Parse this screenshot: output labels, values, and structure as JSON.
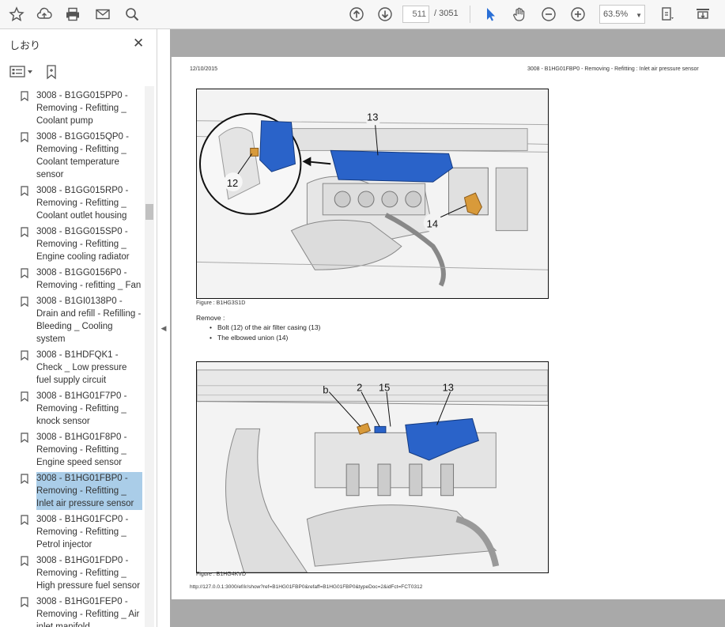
{
  "toolbar": {
    "page_current": "511",
    "page_total": "/ 3051",
    "zoom": "63.5%"
  },
  "sidebar": {
    "title": "しおり",
    "bookmarks": [
      {
        "label": "3008 - B1GG015PP0 - Removing - Refitting _ Coolant pump"
      },
      {
        "label": "3008 - B1GG015QP0 - Removing - Refitting _ Coolant temperature sensor"
      },
      {
        "label": "3008 - B1GG015RP0 - Removing - Refitting _ Coolant outlet housing"
      },
      {
        "label": "3008 - B1GG015SP0 - Removing - Refitting _ Engine cooling radiator"
      },
      {
        "label": "3008 - B1GG0156P0 - Removing - refitting _ Fan"
      },
      {
        "label": "3008 - B1GI0138P0 - Drain and refill - Refilling - Bleeding _ Cooling system"
      },
      {
        "label": "3008 - B1HDFQK1 - Check _ Low pressure fuel supply circuit"
      },
      {
        "label": "3008 - B1HG01F7P0 - Removing - Refitting _ knock sensor"
      },
      {
        "label": "3008 - B1HG01F8P0 - Removing - Refitting _ Engine speed sensor"
      },
      {
        "label": "3008 - B1HG01FBP0 - Removing - Refitting _ Inlet air pressure sensor"
      },
      {
        "label": "3008 - B1HG01FCP0 - Removing - Refitting _ Petrol injector"
      },
      {
        "label": "3008 - B1HG01FDP0 - Removing - Refitting _ High pressure fuel sensor"
      },
      {
        "label": "3008 - B1HG01FEP0 - Removing - Refitting _ Air inlet manifold"
      }
    ]
  },
  "page": {
    "date": "12/10/2015",
    "header_title": "3008 - B1HG01FBP0 - Removing - Refitting : Inlet air pressure sensor",
    "figure1_caption": "Figure : B1HG3S1D",
    "figure1_callouts": [
      "13",
      "12",
      "14"
    ],
    "remove_label": "Remove :",
    "steps": [
      "Bolt (12) of the air filter casing (13)",
      "The elbowed union (14)"
    ],
    "figure2_caption": "Figure : B1HG4KVD",
    "figure2_callouts": [
      "b",
      "2",
      "15",
      "13"
    ],
    "footer_url": "http://127.0.0.1:3000/ef/ir/show?ref=B1HG01FBP0&refaff=B1HG01FBP0&typeDoc=2&idFct=FCT0312"
  },
  "colors": {
    "accent_blue": "#2a6fd6",
    "part_blue": "#1f5fc8",
    "sensor_orange": "#d89a3a",
    "selected_bookmark": "#aacde8",
    "doc_background": "#a9a9a9"
  },
  "icons": [
    "star-icon",
    "upload-icon",
    "print-icon",
    "mail-icon",
    "search-icon",
    "page-up-icon",
    "page-down-icon",
    "select-arrow-icon",
    "hand-icon",
    "zoom-out-icon",
    "zoom-in-icon",
    "fit-page-icon",
    "more-tools-icon"
  ]
}
